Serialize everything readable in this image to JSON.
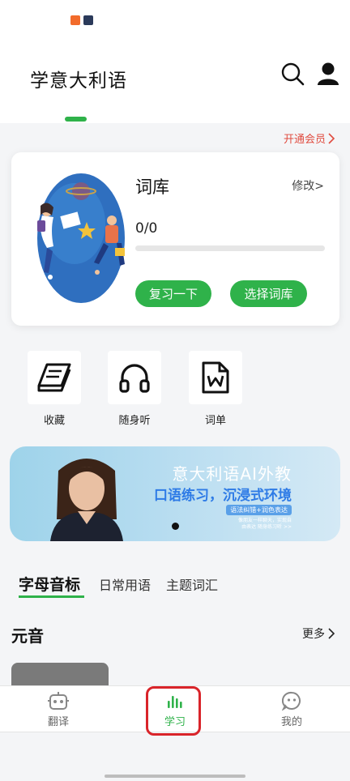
{
  "header": {
    "title": "学意大利语"
  },
  "vip": {
    "label": "开通会员"
  },
  "vocab_card": {
    "title": "词库",
    "edit_label": "修改>",
    "count": "0/0",
    "progress": 0,
    "review_button": "复习一下",
    "choose_button": "选择词库"
  },
  "shortcuts": [
    {
      "label": "收藏",
      "icon": "book-icon"
    },
    {
      "label": "随身听",
      "icon": "headphones-icon"
    },
    {
      "label": "词单",
      "icon": "word-doc-icon"
    }
  ],
  "banner": {
    "title": "意大利语AI外教",
    "subtitle": "口语练习，沉浸式环境",
    "tag": "语法纠错+润色表达",
    "note": "像朋友一样聊天，实现自由表达 随身练习听 >>"
  },
  "topic_tabs": [
    "字母音标",
    "日常用语",
    "主题词汇"
  ],
  "section": {
    "title": "元音",
    "more_label": "更多"
  },
  "bottom_nav": [
    {
      "label": "翻译",
      "icon": "robot-icon"
    },
    {
      "label": "学习",
      "icon": "bars-icon"
    },
    {
      "label": "我的",
      "icon": "face-icon"
    }
  ],
  "colors": {
    "accent": "#2fb24a",
    "vip": "#e04b3f",
    "highlight": "#d9242a"
  }
}
